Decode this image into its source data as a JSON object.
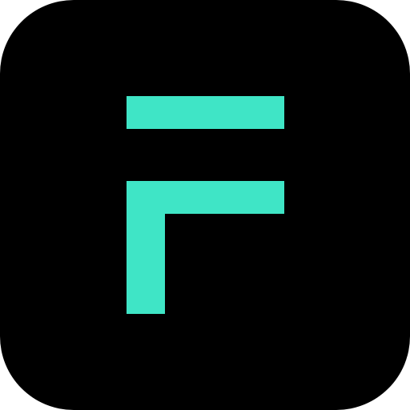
{
  "icon": {
    "name": "f-logo-icon",
    "background_color": "#000000",
    "accent_color": "#3FE5C6"
  }
}
